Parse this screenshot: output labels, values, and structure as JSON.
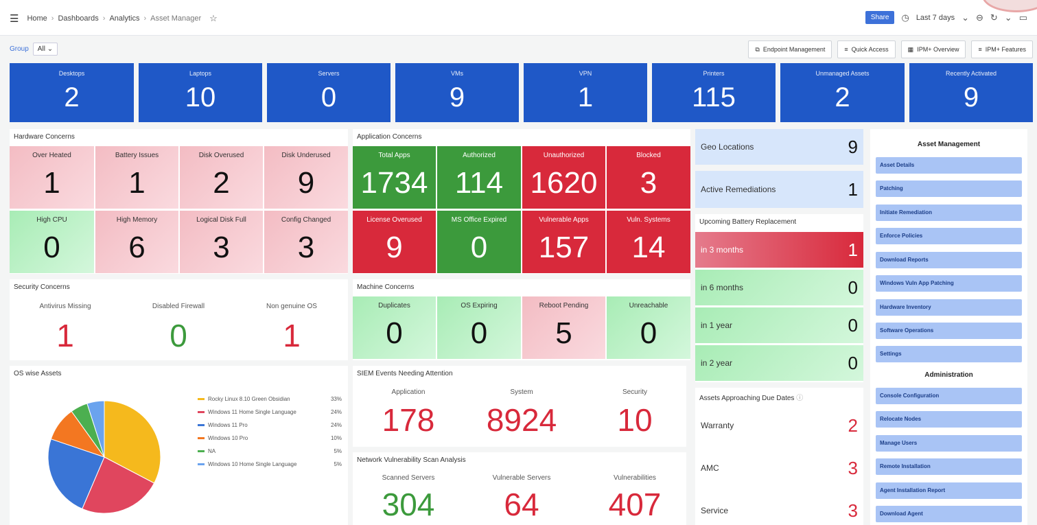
{
  "topbar": {
    "breadcrumbs": [
      "Home",
      "Dashboards",
      "Analytics",
      "Asset Manager"
    ],
    "share_label": "Share",
    "time_range": "Last 7 days"
  },
  "filter": {
    "label": "Group",
    "value": "All"
  },
  "link_buttons": [
    "Endpoint Management",
    "Quick Access",
    "IPM+ Overview",
    "IPM+ Features"
  ],
  "stats": [
    {
      "label": "Desktops",
      "value": "2"
    },
    {
      "label": "Laptops",
      "value": "10"
    },
    {
      "label": "Servers",
      "value": "0"
    },
    {
      "label": "VMs",
      "value": "9"
    },
    {
      "label": "VPN",
      "value": "1"
    },
    {
      "label": "Printers",
      "value": "115"
    },
    {
      "label": "Unmanaged Assets",
      "value": "2"
    },
    {
      "label": "Recently Activated",
      "value": "9"
    }
  ],
  "hardware": {
    "title": "Hardware Concerns",
    "tiles": [
      {
        "label": "Over Heated",
        "value": "1"
      },
      {
        "label": "Battery Issues",
        "value": "1"
      },
      {
        "label": "Disk Overused",
        "value": "2"
      },
      {
        "label": "Disk Underused",
        "value": "9"
      },
      {
        "label": "High CPU",
        "value": "0"
      },
      {
        "label": "High Memory",
        "value": "6"
      },
      {
        "label": "Logical Disk Full",
        "value": "3"
      },
      {
        "label": "Config Changed",
        "value": "3"
      }
    ]
  },
  "application": {
    "title": "Application Concerns",
    "tiles": [
      {
        "label": "Total Apps",
        "value": "1734"
      },
      {
        "label": "Authorized",
        "value": "114"
      },
      {
        "label": "Unauthorized",
        "value": "1620"
      },
      {
        "label": "Blocked",
        "value": "3"
      },
      {
        "label": "License Overused",
        "value": "9"
      },
      {
        "label": "MS Office Expired",
        "value": "0"
      },
      {
        "label": "Vulnerable Apps",
        "value": "157"
      },
      {
        "label": "Vuln. Systems",
        "value": "14"
      }
    ]
  },
  "security": {
    "title": "Security Concerns",
    "items": [
      {
        "label": "Antivirus Missing",
        "value": "1"
      },
      {
        "label": "Disabled Firewall",
        "value": "0"
      },
      {
        "label": "Non genuine OS",
        "value": "1"
      }
    ]
  },
  "machine": {
    "title": "Machine Concerns",
    "tiles": [
      {
        "label": "Duplicates",
        "value": "0"
      },
      {
        "label": "OS Expiring",
        "value": "0"
      },
      {
        "label": "Reboot Pending",
        "value": "5"
      },
      {
        "label": "Unreachable",
        "value": "0"
      }
    ]
  },
  "geo": {
    "label": "Geo Locations",
    "value": "9"
  },
  "remediations": {
    "label": "Active Remediations",
    "value": "1"
  },
  "battery": {
    "title": "Upcoming Battery Replacement",
    "rows": [
      {
        "label": "in 3 months",
        "value": "1"
      },
      {
        "label": "in 6 months",
        "value": "0"
      },
      {
        "label": "in 1 year",
        "value": "0"
      },
      {
        "label": "in 2 year",
        "value": "0"
      }
    ]
  },
  "due": {
    "title": "Assets Approaching Due Dates",
    "rows": [
      {
        "label": "Warranty",
        "value": "2"
      },
      {
        "label": "AMC",
        "value": "3"
      },
      {
        "label": "Service",
        "value": "3"
      }
    ]
  },
  "siem": {
    "title": "SIEM Events Needing Attention",
    "items": [
      {
        "label": "Application",
        "value": "178"
      },
      {
        "label": "System",
        "value": "8924"
      },
      {
        "label": "Security",
        "value": "10"
      }
    ]
  },
  "network": {
    "title": "Network Vulnerability Scan Analysis",
    "items": [
      {
        "label": "Scanned Servers",
        "value": "304"
      },
      {
        "label": "Vulnerable Servers",
        "value": "64"
      },
      {
        "label": "Vulnerabilities",
        "value": "407"
      }
    ]
  },
  "os": {
    "title": "OS wise Assets",
    "legend": [
      {
        "name": "Rocky Linux 8.10 Green Obsidian",
        "pct": "33%",
        "value": 33,
        "color": "#f5b91d"
      },
      {
        "name": "Windows 11 Home Single Language",
        "pct": "24%",
        "value": 24,
        "color": "#e0465e"
      },
      {
        "name": "Windows 11 Pro",
        "pct": "24%",
        "value": 24,
        "color": "#3a75d6"
      },
      {
        "name": "Windows 10 Pro",
        "pct": "10%",
        "value": 10,
        "color": "#f37721"
      },
      {
        "name": "NA",
        "pct": "5%",
        "value": 5,
        "color": "#4caf50"
      },
      {
        "name": "Windows 10 Home Single Language",
        "pct": "5%",
        "value": 5,
        "color": "#6aa3ee"
      }
    ]
  },
  "asset_menu": {
    "title": "Asset Management",
    "items": [
      "Asset Details",
      "Patching",
      "Initiate Remediation",
      "Enforce Policies",
      "Download Reports",
      "Windows Vuln App Patching",
      "Hardware Inventory",
      "Software Operations",
      "Settings"
    ]
  },
  "admin_menu": {
    "title": "Administration",
    "items": [
      "Console Configuration",
      "Relocate Nodes",
      "Manage Users",
      "Remote Installation",
      "Agent Installation Report",
      "Download Agent"
    ]
  },
  "colors": {
    "stat_blue": "#1f58c7",
    "red_value": "#d8293b",
    "green_value": "#3c9a3c",
    "menu_blue": "#a9c4f5"
  }
}
